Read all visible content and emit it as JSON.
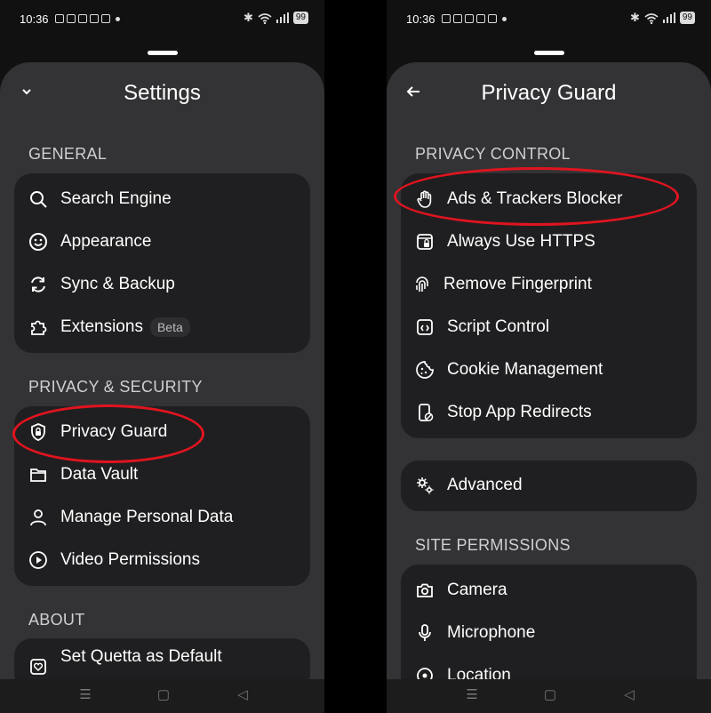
{
  "status": {
    "time": "10:36",
    "battery": "99"
  },
  "left": {
    "title": "Settings",
    "sections": {
      "general": "GENERAL",
      "privacy": "PRIVACY & SECURITY",
      "about": "ABOUT"
    },
    "general_items": [
      "Search Engine",
      "Appearance",
      "Sync & Backup",
      "Extensions"
    ],
    "extensions_badge": "Beta",
    "privacy_items": [
      "Privacy Guard",
      "Data Vault",
      "Manage Personal Data",
      "Video Permissions"
    ],
    "about_items": [
      "Set Quetta as Default"
    ]
  },
  "right": {
    "title": "Privacy Guard",
    "sections": {
      "privacy_control": "PRIVACY CONTROL",
      "site_permissions": "SITE PERMISSIONS"
    },
    "control_items": [
      "Ads & Trackers Blocker",
      "Always Use HTTPS",
      "Remove Fingerprint",
      "Script Control",
      "Cookie Management",
      "Stop App Redirects"
    ],
    "advanced": "Advanced",
    "permission_items": [
      "Camera",
      "Microphone",
      "Location"
    ]
  },
  "colors": {
    "annotation": "#e0141f",
    "sheet": "#333335",
    "card": "#1f1f21"
  }
}
